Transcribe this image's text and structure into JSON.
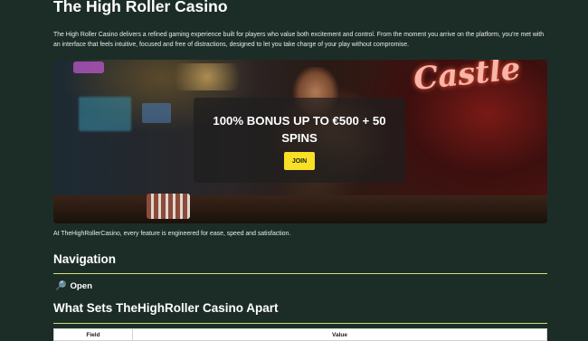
{
  "page": {
    "title": "The High Roller Casino",
    "intro": "The High Roller Casino delivers a refined gaming experience built for players who value both excitement and control. From the moment you arrive on the platform, you're met with an interface that feels intuitive, focused and free of distractions, designed to let you take charge of your play without compromise.",
    "caption": "At TheHighRollerCasino, every feature is engineered for ease, speed and satisfaction."
  },
  "hero": {
    "neon_sign": "Castle",
    "promo_text": "100% BONUS UP TO €500 + 50 SPINS",
    "join_label": "JOIN"
  },
  "navigation": {
    "heading": "Navigation",
    "toggle_label": "Open",
    "toggle_icon": "search-icon"
  },
  "features": {
    "heading": "What Sets TheHighRoller Casino Apart",
    "table": {
      "columns": [
        "Field",
        "Value"
      ]
    }
  },
  "colors": {
    "background": "#1c2d27",
    "accent_rule": "#cfe07a",
    "button": "#f7e025"
  }
}
